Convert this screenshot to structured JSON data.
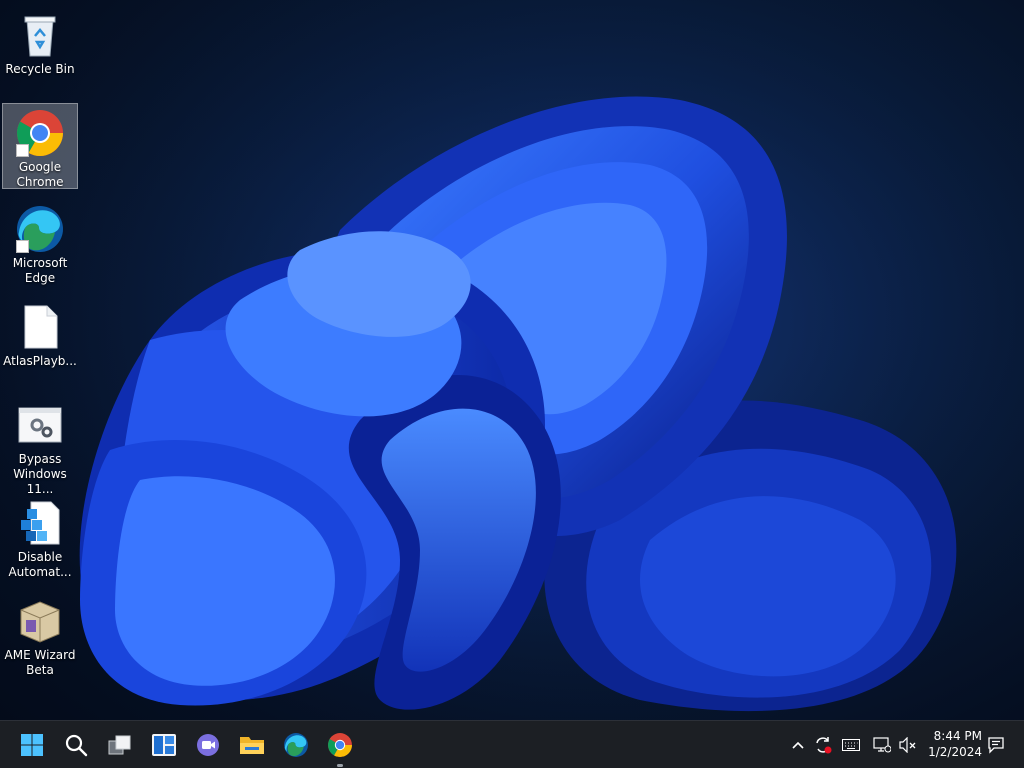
{
  "desktop": {
    "icons": [
      {
        "label": "Recycle Bin",
        "icon": "recycle-bin-icon"
      },
      {
        "label": "Google\nChrome",
        "icon": "chrome-icon",
        "selected": true
      },
      {
        "label": "Microsoft\nEdge",
        "icon": "edge-icon"
      },
      {
        "label": "AtlasPlayb...",
        "icon": "blank-file-icon"
      },
      {
        "label": "Bypass\nWindows 11...",
        "icon": "settings-file-icon"
      },
      {
        "label": "Disable\nAutomat...",
        "icon": "registry-icon"
      },
      {
        "label": "AME Wizard\nBeta",
        "icon": "wizard-box-icon"
      }
    ]
  },
  "taskbar": {
    "apps": [
      "start-icon",
      "search-icon",
      "task-view-icon",
      "widgets-icon",
      "chat-icon",
      "file-explorer-icon",
      "edge-icon",
      "chrome-icon"
    ],
    "tray": [
      "chevron-up-icon",
      "update-icon",
      "keyboard-icon",
      "network-icon",
      "volume-muted-icon"
    ],
    "clock": {
      "time": "8:44 PM",
      "date": "1/2/2024"
    },
    "notification": "notification-icon"
  },
  "colors": {
    "wallpaper_bg": "#081a36",
    "bloom_blue": "#1f4fe0",
    "taskbar_bg": "#1c1f24"
  }
}
